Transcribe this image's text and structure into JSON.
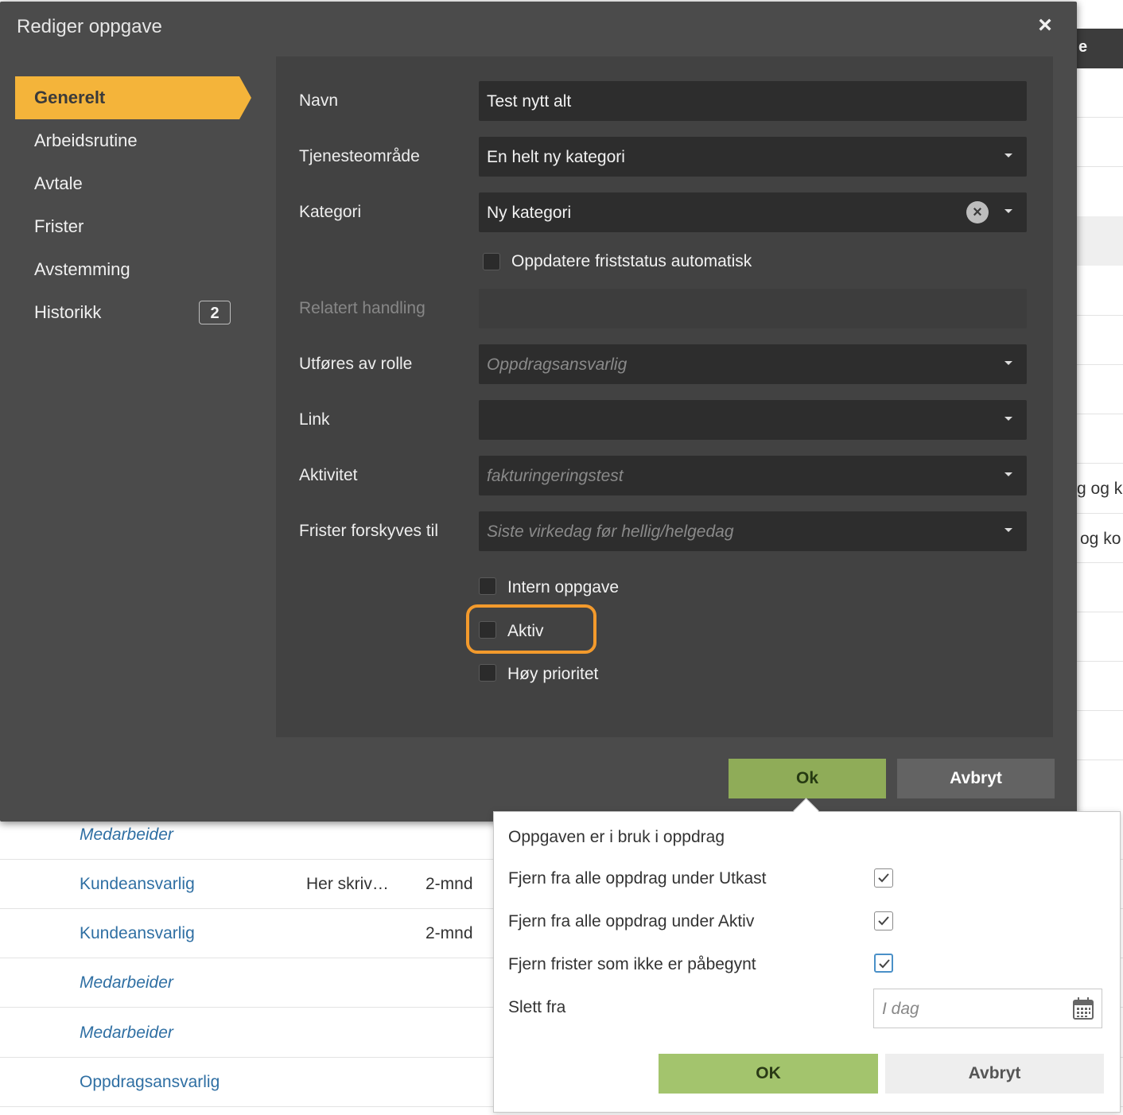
{
  "background": {
    "header_fragment": "e",
    "right_fragments": [
      "g og k",
      "og ko"
    ],
    "rows": [
      {
        "role": "Medarbeider",
        "italic": true,
        "note": "",
        "freq": ""
      },
      {
        "role": "Kundeansvarlig",
        "italic": false,
        "note": "Her skriv…",
        "freq": "2-mnd"
      },
      {
        "role": "Kundeansvarlig",
        "italic": false,
        "note": "",
        "freq": "2-mnd"
      },
      {
        "role": "Medarbeider",
        "italic": true,
        "note": "",
        "freq": ""
      },
      {
        "role": "Medarbeider",
        "italic": true,
        "note": "",
        "freq": ""
      },
      {
        "role": "Oppdragsansvarlig",
        "italic": false,
        "note": "",
        "freq": ""
      }
    ]
  },
  "modal": {
    "title": "Rediger oppgave",
    "close_label": "×",
    "nav": [
      {
        "label": "Generelt",
        "active": true
      },
      {
        "label": "Arbeidsrutine"
      },
      {
        "label": "Avtale"
      },
      {
        "label": "Frister"
      },
      {
        "label": "Avstemming"
      },
      {
        "label": "Historikk",
        "badge": "2"
      }
    ],
    "form": {
      "navn_label": "Navn",
      "navn_value": "Test nytt alt",
      "tjenesteomrade_label": "Tjenesteområde",
      "tjenesteomrade_value": "En helt ny kategori",
      "kategori_label": "Kategori",
      "kategori_value": "Ny kategori",
      "kategori_clear": "×",
      "oppdatere_label": "Oppdatere friststatus automatisk",
      "relatert_label": "Relatert handling",
      "rolle_label": "Utføres av rolle",
      "rolle_placeholder": "Oppdragsansvarlig",
      "link_label": "Link",
      "aktivitet_label": "Aktivitet",
      "aktivitet_placeholder": "fakturingeringstest",
      "frister_label": "Frister forskyves til",
      "frister_placeholder": "Siste virkedag før hellig/helgedag",
      "intern_label": "Intern oppgave",
      "aktiv_label": "Aktiv",
      "hoy_label": "Høy prioritet"
    },
    "ok_label": "Ok",
    "cancel_label": "Avbryt"
  },
  "popover": {
    "heading": "Oppgaven er i bruk i oppdrag",
    "option_utkast": "Fjern fra alle oppdrag under Utkast",
    "option_aktiv": "Fjern fra alle oppdrag under Aktiv",
    "option_frister": "Fjern frister som ikke er påbegynt",
    "slett_label": "Slett fra",
    "date_placeholder": "I dag",
    "ok_label": "OK",
    "cancel_label": "Avbryt"
  },
  "colors": {
    "accent": "#f4b43a",
    "ok_green": "#8fac58",
    "highlight": "#f39a2c",
    "link_blue": "#2f6fa3"
  }
}
